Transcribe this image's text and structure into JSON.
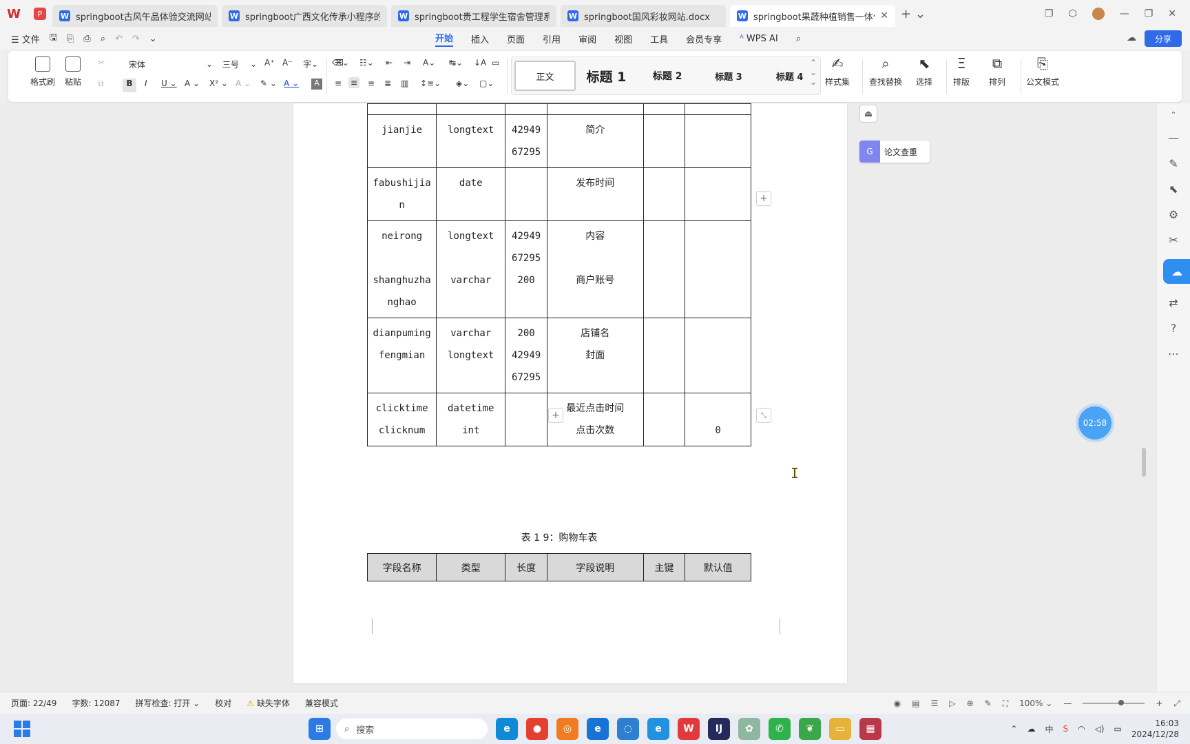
{
  "tabs": [
    {
      "title": "springboot古风午品体验交流网站的",
      "active": false
    },
    {
      "title": "springboot广西文化传承小程序的设",
      "active": false
    },
    {
      "title": "springboot贵工程学生宿舍管理系统",
      "active": false
    },
    {
      "title": "springboot国风彩妆网站.docx",
      "active": false
    },
    {
      "title": "springboot果蔬种植销售一体化服",
      "active": true
    }
  ],
  "menu": {
    "file": "文件",
    "items": [
      "开始",
      "插入",
      "页面",
      "引用",
      "审阅",
      "视图",
      "工具",
      "会员专享"
    ],
    "wps_ai": "WPS AI",
    "share": "分享"
  },
  "ribbon": {
    "format_painter": "格式刷",
    "paste": "粘贴",
    "font_name": "宋体",
    "font_size": "三号",
    "styles": [
      "正文",
      "标题 1",
      "标题 2",
      "标题 3",
      "标题 4"
    ],
    "style_set": "样式集",
    "find_replace": "查找替换",
    "select": "选择",
    "layout": "排版",
    "arrange": "排列",
    "official_mode": "公文模式"
  },
  "table_upper": {
    "rows": [
      {
        "name": [
          "jianjie"
        ],
        "type": [
          "longtext"
        ],
        "len": [
          "42949",
          "67295"
        ],
        "desc": [
          "简介"
        ],
        "pk": "",
        "default": ""
      },
      {
        "name": [
          "fabushijia",
          "n"
        ],
        "type": [
          "date"
        ],
        "len": [],
        "desc": [
          "发布时间"
        ],
        "pk": "",
        "default": ""
      },
      {
        "name": [
          "neirong",
          "",
          "shanghuzha",
          "nghao"
        ],
        "type": [
          "longtext",
          "",
          "varchar"
        ],
        "len": [
          "42949",
          "67295",
          "200"
        ],
        "desc": [
          "内容",
          "",
          "商户账号"
        ],
        "pk": "",
        "default": ""
      },
      {
        "name": [
          "dianpuming",
          "fengmian"
        ],
        "type": [
          "varchar",
          "longtext"
        ],
        "len": [
          "200",
          "42949",
          "67295"
        ],
        "desc": [
          "店铺名",
          "封面"
        ],
        "pk": "",
        "default": ""
      },
      {
        "name": [
          "clicktime",
          "clicknum"
        ],
        "type": [
          "datetime",
          "int"
        ],
        "len": [],
        "desc": [
          "最近点击时间",
          "点击次数"
        ],
        "pk": "",
        "default": "0"
      }
    ]
  },
  "caption": "表 1 9：购物车表",
  "table_header": [
    "字段名称",
    "类型",
    "长度",
    "字段说明",
    "主键",
    "默认值"
  ],
  "review_label": "论文查重",
  "timer": "02:58",
  "status": {
    "page": "页面: 22/49",
    "words": "字数: 12087",
    "spell": "拼写检查: 打开",
    "proof": "校对",
    "missing_font": "缺失字体",
    "compat": "兼容模式",
    "zoom": "100%"
  },
  "taskbar": {
    "search": "搜索",
    "time": "16:03",
    "date": "2024/12/28"
  },
  "colors": {
    "accent": "#2f6be8",
    "header_fill": "#d9d9d9"
  }
}
